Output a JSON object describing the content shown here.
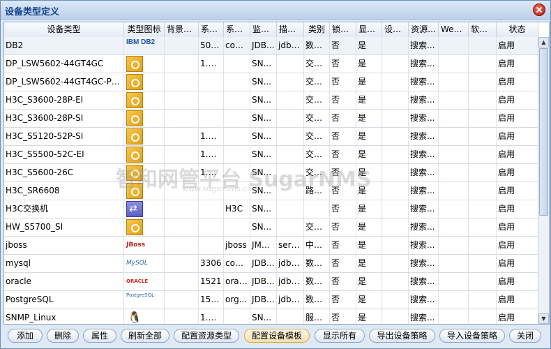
{
  "window": {
    "title": "设备类型定义"
  },
  "columns": [
    "设备类型",
    "类型图标",
    "背景图...",
    "系统...",
    "系统...",
    "监控...",
    "描述...",
    "类别",
    "锁定...",
    "显示...",
    "设备...",
    "资源...",
    "Web...",
    "软件...",
    "状态"
  ],
  "rows": [
    {
      "name": "DB2",
      "icon": "ibm-db2-icon",
      "iconText": "IBM DB2",
      "c3": "",
      "c4": "50000",
      "c5": "com...",
      "c6": "JDB...",
      "c7": "jdbc...",
      "c8": "数据...",
      "c9": "否",
      "c10": "是",
      "c11": "",
      "c12": "搜索...",
      "c13": "",
      "c14": "",
      "c15": "启用"
    },
    {
      "name": "DP_LSW5602-44GT4GC",
      "icon": "device-icon",
      "iconText": "",
      "c3": "",
      "c4": "1.3....",
      "c5": "",
      "c6": "SN...",
      "c7": "",
      "c8": "交换...",
      "c9": "否",
      "c10": "是",
      "c11": "",
      "c12": "搜索...",
      "c13": "",
      "c14": "",
      "c15": "启用"
    },
    {
      "name": "DP_LSW5602-44GT4GC-PWR",
      "icon": "device-icon",
      "iconText": "",
      "c3": "",
      "c4": "",
      "c5": "",
      "c6": "SN...",
      "c7": "",
      "c8": "交换...",
      "c9": "否",
      "c10": "是",
      "c11": "",
      "c12": "搜索...",
      "c13": "",
      "c14": "",
      "c15": "启用"
    },
    {
      "name": "H3C_S3600-28P-EI",
      "icon": "device-icon",
      "iconText": "",
      "c3": "",
      "c4": "",
      "c5": "",
      "c6": "SN...",
      "c7": "",
      "c8": "交换...",
      "c9": "否",
      "c10": "是",
      "c11": "",
      "c12": "搜索...",
      "c13": "",
      "c14": "",
      "c15": "启用"
    },
    {
      "name": "H3C_S3600-28P-SI",
      "icon": "device-icon",
      "iconText": "",
      "c3": "",
      "c4": "",
      "c5": "",
      "c6": "SN...",
      "c7": "",
      "c8": "交换...",
      "c9": "否",
      "c10": "是",
      "c11": "",
      "c12": "搜索...",
      "c13": "",
      "c14": "",
      "c15": "启用"
    },
    {
      "name": "H3C_S5120-52P-SI",
      "icon": "device-icon",
      "iconText": "",
      "c3": "",
      "c4": "1.3....",
      "c5": "",
      "c6": "SN...",
      "c7": "",
      "c8": "交换...",
      "c9": "否",
      "c10": "是",
      "c11": "",
      "c12": "搜索...",
      "c13": "",
      "c14": "",
      "c15": "启用"
    },
    {
      "name": "H3C_S5500-52C-EI",
      "icon": "device-icon",
      "iconText": "",
      "c3": "",
      "c4": "1.3....",
      "c5": "",
      "c6": "SN...",
      "c7": "",
      "c8": "交换...",
      "c9": "否",
      "c10": "是",
      "c11": "",
      "c12": "搜索...",
      "c13": "",
      "c14": "",
      "c15": "启用"
    },
    {
      "name": "H3C_S5600-26C",
      "icon": "device-icon",
      "iconText": "",
      "c3": "",
      "c4": "1.3....",
      "c5": "",
      "c6": "SN...",
      "c7": "",
      "c8": "交换...",
      "c9": "否",
      "c10": "是",
      "c11": "",
      "c12": "搜索...",
      "c13": "",
      "c14": "",
      "c15": "启用"
    },
    {
      "name": "H3C_SR6608",
      "icon": "device-icon",
      "iconText": "",
      "c3": "",
      "c4": "",
      "c5": "",
      "c6": "SN...",
      "c7": "",
      "c8": "路由...",
      "c9": "否",
      "c10": "是",
      "c11": "",
      "c12": "搜索...",
      "c13": "",
      "c14": "",
      "c15": "启用"
    },
    {
      "name": "H3C交换机",
      "icon": "switch-icon",
      "iconText": "",
      "c3": "",
      "c4": "",
      "c5": "H3C",
      "c6": "SN...",
      "c7": "",
      "c8": "",
      "c9": "否",
      "c10": "是",
      "c11": "",
      "c12": "搜索...",
      "c13": "",
      "c14": "",
      "c15": "启用"
    },
    {
      "name": "HW_S5700_SI",
      "icon": "device-icon",
      "iconText": "",
      "c3": "",
      "c4": "",
      "c5": "",
      "c6": "SN...",
      "c7": "",
      "c8": "交换...",
      "c9": "否",
      "c10": "是",
      "c11": "",
      "c12": "搜索...",
      "c13": "",
      "c14": "",
      "c15": "启用"
    },
    {
      "name": "jboss",
      "icon": "jboss-icon",
      "iconText": "JBoss",
      "c3": "",
      "c4": "",
      "c5": "jboss",
      "c6": "JMX...",
      "c7": "servi...",
      "c8": "中间...",
      "c9": "否",
      "c10": "是",
      "c11": "",
      "c12": "搜索...",
      "c13": "",
      "c14": "",
      "c15": "启用"
    },
    {
      "name": "mysql",
      "icon": "mysql-icon",
      "iconText": "MySQL",
      "c3": "",
      "c4": "3306",
      "c5": "com...",
      "c6": "JDB...",
      "c7": "jdbc...",
      "c8": "数据...",
      "c9": "否",
      "c10": "是",
      "c11": "",
      "c12": "搜索...",
      "c13": "",
      "c14": "",
      "c15": "启用"
    },
    {
      "name": "oracle",
      "icon": "oracle-icon",
      "iconText": "ORACLE",
      "c3": "",
      "c4": "1521",
      "c5": "orac...",
      "c6": "JDB...",
      "c7": "jdbc...",
      "c8": "数据...",
      "c9": "否",
      "c10": "是",
      "c11": "",
      "c12": "搜索...",
      "c13": "",
      "c14": "",
      "c15": "启用"
    },
    {
      "name": "PostgreSQL",
      "icon": "postgresql-icon",
      "iconText": "PostgreSQL",
      "c3": "",
      "c4": "15433",
      "c5": "org...",
      "c6": "JDB...",
      "c7": "jdbc...",
      "c8": "数据...",
      "c9": "否",
      "c10": "是",
      "c11": "",
      "c12": "搜索...",
      "c13": "",
      "c14": "",
      "c15": "启用"
    },
    {
      "name": "SNMP_Linux",
      "icon": "linux-icon",
      "iconText": "🐧",
      "c3": "",
      "c4": "1.3....",
      "c5": "",
      "c6": "SN...",
      "c7": "",
      "c8": "服务...",
      "c9": "否",
      "c10": "是",
      "c11": "",
      "c12": "搜索...",
      "c13": "",
      "c14": "",
      "c15": "启用"
    }
  ],
  "watermark": {
    "main": "智和网管平台 SugarNMS",
    "sub": "www.sugarnms.com"
  },
  "buttons": [
    "添加",
    "删除",
    "属性",
    "刷新全部",
    "配置资源类型",
    "配置设备模板",
    "显示所有",
    "导出设备策略",
    "导入设备策略",
    "关闭"
  ]
}
